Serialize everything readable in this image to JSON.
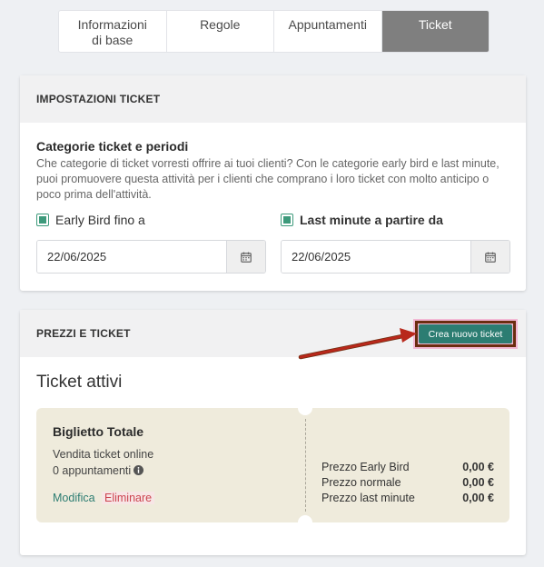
{
  "tabs": [
    {
      "label": "Informazioni\ndi base"
    },
    {
      "label": "Regole"
    },
    {
      "label": "Appuntamenti"
    },
    {
      "label": "Ticket"
    }
  ],
  "settings": {
    "header": "IMPOSTAZIONI TICKET",
    "section_title": "Categorie ticket e periodi",
    "description": "Che categorie di ticket vorresti offrire ai tuoi clienti? Con le categorie early bird e last minute, puoi promuovere questa attività per i clienti che comprano i loro ticket con molto anticipo o poco prima dell'attività.",
    "early_bird": {
      "label": "Early Bird fino a",
      "date": "22/06/2025",
      "checked": true
    },
    "last_minute": {
      "label": "Last minute a partire da",
      "date": "22/06/2025",
      "checked": true
    }
  },
  "prices": {
    "header": "PREZZI E TICKET",
    "create_button": "Crea nuovo ticket",
    "active_title": "Ticket attivi",
    "ticket": {
      "name": "Biglietto Totale",
      "sale_type": "Vendita ticket online",
      "appointments": "0 appuntamenti",
      "edit": "Modifica",
      "delete": "Eliminare",
      "early_bird_label": "Prezzo Early Bird",
      "early_bird_value": "0,00 €",
      "normal_label": "Prezzo normale",
      "normal_value": "0,00 €",
      "last_minute_label": "Prezzo last minute",
      "last_minute_value": "0,00 €"
    }
  },
  "colors": {
    "accent": "#2c7d72",
    "checkbox": "#3d9a7b",
    "active_tab": "#7f7f7f",
    "ticket_bg": "#efebdc",
    "delete": "#cc4450",
    "annotation_arrow": "#b8281b",
    "annotation_box": "#6b2d10"
  }
}
